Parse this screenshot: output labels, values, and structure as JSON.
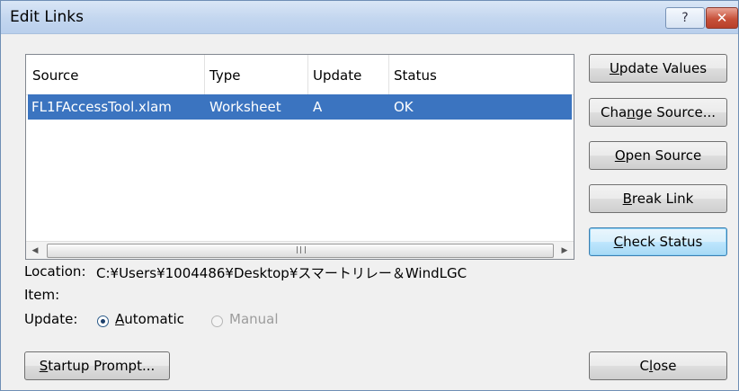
{
  "window": {
    "title": "Edit Links",
    "help_glyph": "?",
    "close_glyph": "✕"
  },
  "list": {
    "columns": [
      "Source",
      "Type",
      "Update",
      "Status"
    ],
    "rows": [
      {
        "source": "FL1FAccessTool.xlam",
        "type": "Worksheet",
        "update": "A",
        "status": "OK"
      }
    ],
    "scroll_left": "◀",
    "scroll_right": "▶"
  },
  "buttons": {
    "update_values": {
      "pre": "",
      "key": "U",
      "post": "pdate Values"
    },
    "change_source": {
      "pre": "Cha",
      "key": "n",
      "post": "ge Source..."
    },
    "open_source": {
      "pre": "",
      "key": "O",
      "post": "pen Source"
    },
    "break_link": {
      "pre": "",
      "key": "B",
      "post": "reak Link"
    },
    "check_status": {
      "pre": "",
      "key": "C",
      "post": "heck Status"
    },
    "startup_prompt": {
      "pre": "",
      "key": "S",
      "post": "tartup Prompt..."
    },
    "close": {
      "pre": "C",
      "key": "l",
      "post": "ose"
    }
  },
  "details": {
    "location_label": "Location:",
    "location_value": "C:¥Users¥1004486¥Desktop¥スマートリレー＆WindLGC",
    "item_label": "Item:",
    "item_value": "",
    "update_label": "Update:",
    "automatic": {
      "pre": "",
      "key": "A",
      "post": "utomatic",
      "selected": true
    },
    "manual": {
      "label": "Manual",
      "enabled": false
    }
  },
  "colors": {
    "selection": "#3b74c0",
    "title_bar": "#c3d6ef",
    "close_button": "#c7513a"
  }
}
